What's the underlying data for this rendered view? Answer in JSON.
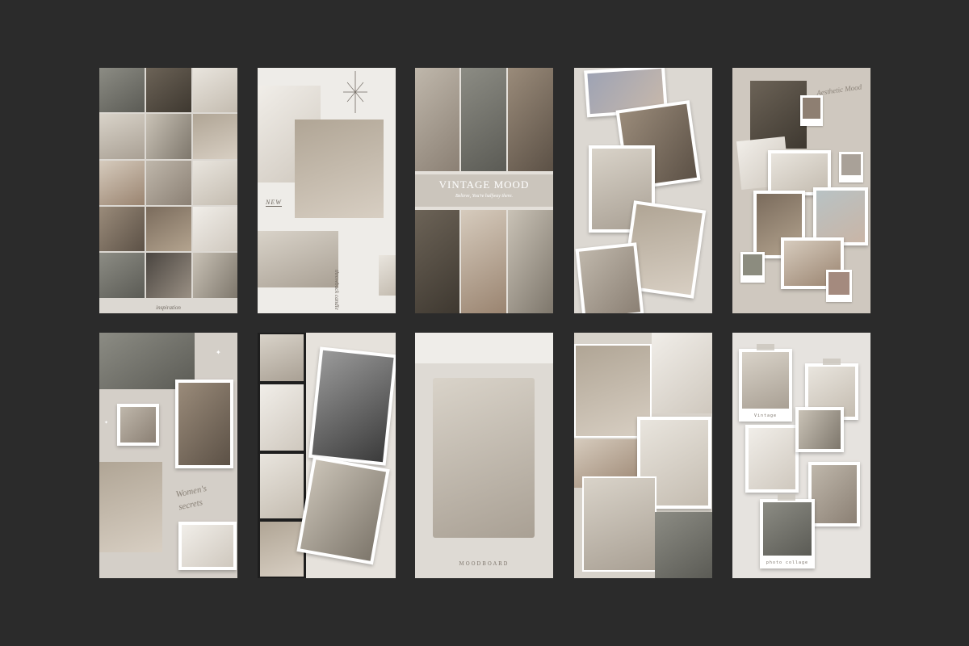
{
  "templates": {
    "t1_caption": "inspiration",
    "t2_label_new": "NEW",
    "t2_side_text": "throwback candle",
    "t3_title": "VINTAGE MOOD",
    "t3_subtitle": "Believe, You're halfway there.",
    "t5_script": "Aesthetic Mood",
    "t6_script": "Women's secrets",
    "t8_caption": "MOODBOARD",
    "t10_caption1": "Vintage",
    "t10_caption2": "photo collage"
  },
  "colors": {
    "background": "#2b2b2b",
    "card": "#e7e4df",
    "swatch_taupe": "#8e7f72",
    "swatch_sage": "#8c8c7f",
    "swatch_dusty_rose": "#a48a7e",
    "swatch_stone": "#a9a198"
  }
}
